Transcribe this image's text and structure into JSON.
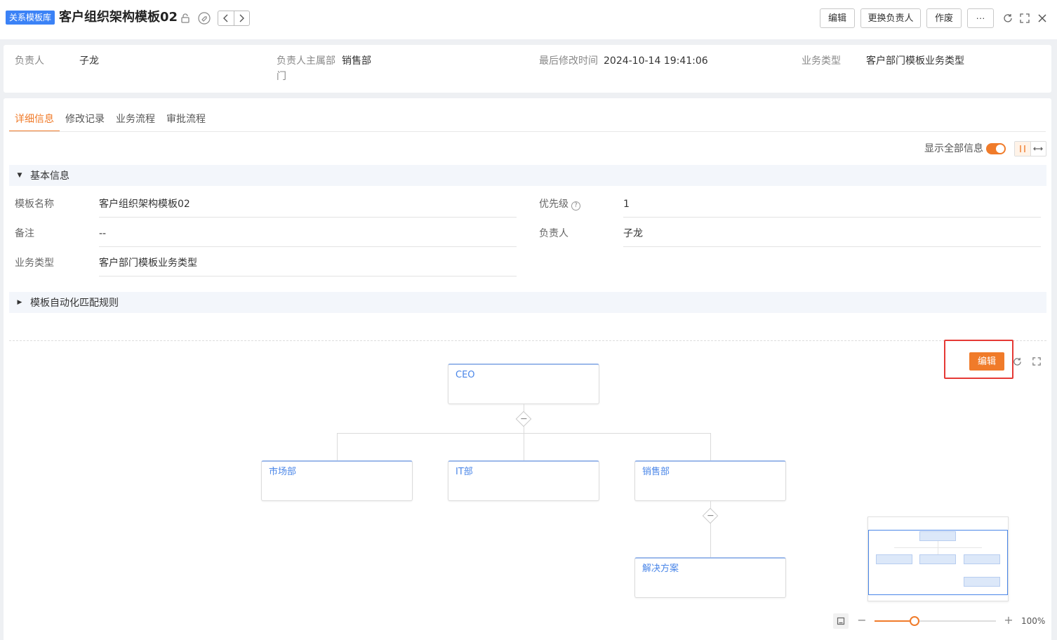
{
  "header": {
    "badge": "关系模板库",
    "title": "客户组织架构模板02",
    "buttons": {
      "edit": "编辑",
      "change_owner": "更换负责人",
      "void": "作废",
      "more": "···"
    }
  },
  "summary": {
    "owner_label": "负责人",
    "owner_value": "子龙",
    "dept_label_line1": "负责人主属部",
    "dept_label_line2": "门",
    "dept_value": "销售部",
    "modified_label": "最后修改时间",
    "modified_value": "2024-10-14 19:41:06",
    "biztype_label": "业务类型",
    "biztype_value": "客户部门模板业务类型"
  },
  "tabs": [
    {
      "label": "详细信息",
      "active": true
    },
    {
      "label": "修改记录",
      "active": false
    },
    {
      "label": "业务流程",
      "active": false
    },
    {
      "label": "审批流程",
      "active": false
    }
  ],
  "toolbar": {
    "show_all_label": "显示全部信息",
    "show_all_on": true
  },
  "basic_section": {
    "title": "基本信息",
    "fields": {
      "name_label": "模板名称",
      "name_value": "客户组织架构模板02",
      "priority_label": "优先级",
      "priority_value": "1",
      "remark_label": "备注",
      "remark_value": "--",
      "owner_label": "负责人",
      "owner_value": "子龙",
      "biztype_label": "业务类型",
      "biztype_value": "客户部门模板业务类型"
    }
  },
  "rules_section": {
    "title": "模板自动化匹配规则"
  },
  "org_chart": {
    "edit_label": "编辑",
    "nodes": {
      "root": "CEO",
      "market": "市场部",
      "it": "IT部",
      "sales": "销售部",
      "solution": "解决方案"
    },
    "zoom_percent": "100%",
    "zoom_fraction": 0.33
  },
  "colors": {
    "accent": "#f07b2a",
    "node_text": "#4a86e8",
    "badge": "#3b82f6",
    "highlight_frame": "#e53935"
  }
}
